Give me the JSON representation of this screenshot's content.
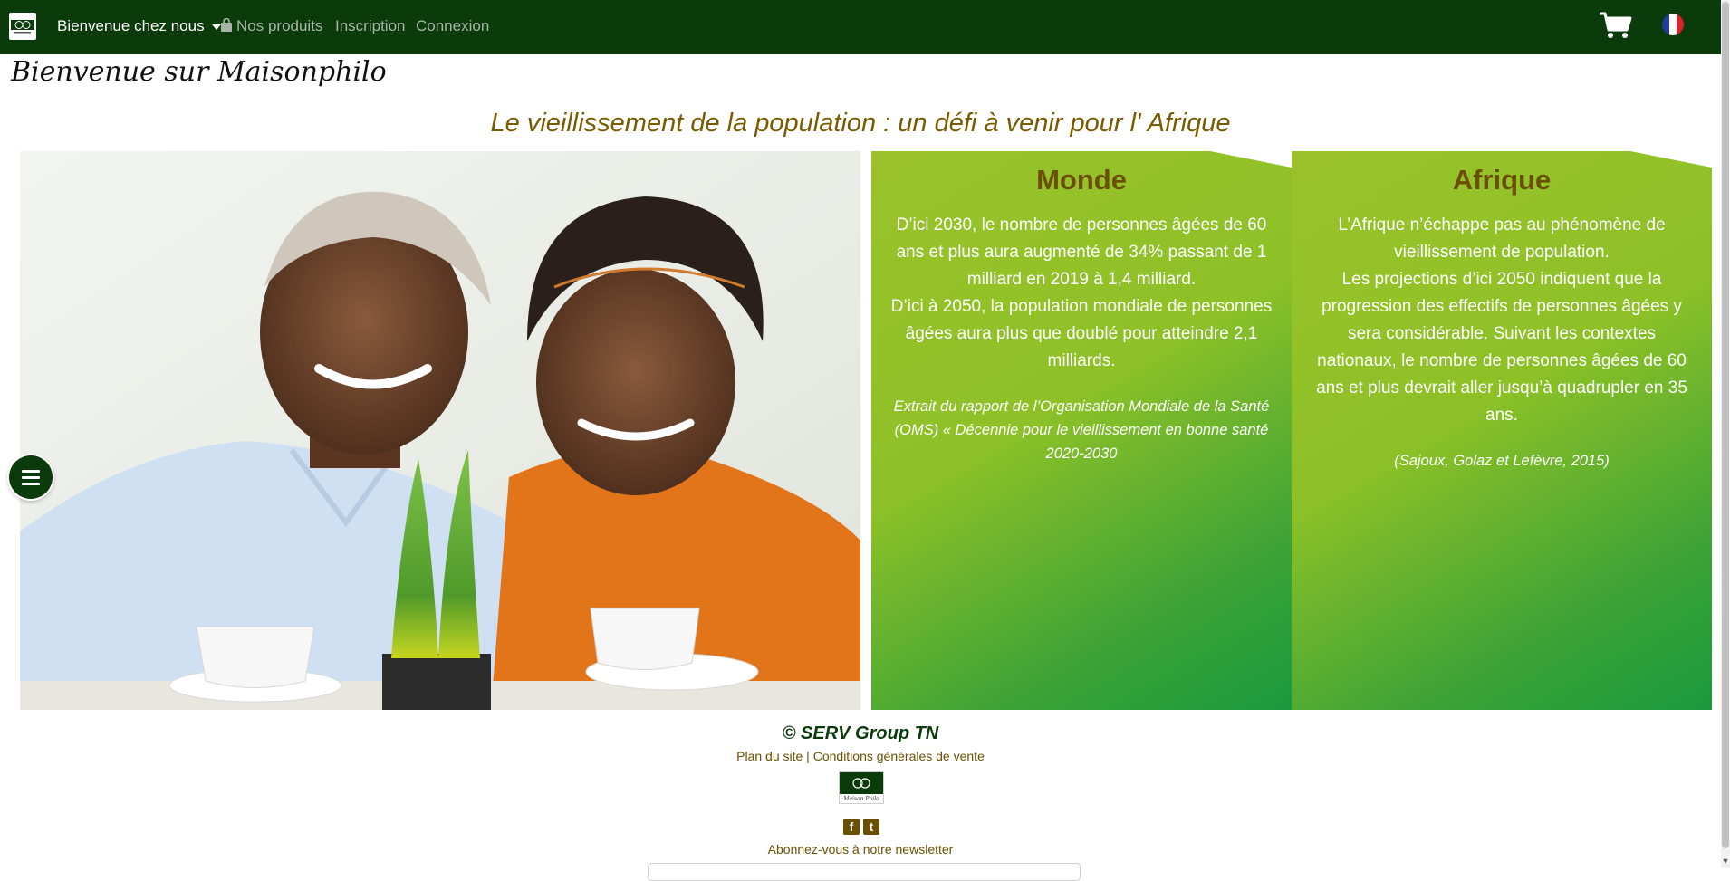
{
  "navbar": {
    "menu_label": "Bienvenue chez nous",
    "products_label": "Nos produits",
    "signup_label": "Inscription",
    "login_label": "Connexion",
    "colors": {
      "background": "#0b3a0b",
      "active": "#ffffff",
      "muted": "#a8b6a8"
    }
  },
  "page": {
    "welcome": "Bienvenue sur Maisonphilo",
    "subtitle": "Le vieillissement de la population : un défi à venir pour l' Afrique"
  },
  "cards": [
    {
      "title": "Monde",
      "paragraph_1": "D’ici 2030, le nombre de personnes âgées de 60 ans et plus aura augmenté de 34% passant de 1 milliard en 2019 à 1,4 milliard.",
      "paragraph_2": "D’ici à 2050, la population mondiale de personnes âgées aura plus que doublé pour atteindre 2,1 milliards.",
      "source": "Extrait du rapport de l’Organisation Mondiale de la Santé (OMS) « Décennie pour le vieillissement en bonne santé 2020-2030"
    },
    {
      "title": "Afrique",
      "paragraph_1": "L’Afrique n’échappe pas au phénomène de vieillissement de population.",
      "paragraph_2": "Les projections d’ici 2050 indiquent que la progression des effectifs de personnes âgées y sera considérable. Suivant les contextes nationaux, le nombre de personnes âgées de 60 ans et plus devrait aller jusqu’à quadrupler en 35 ans.",
      "source": "(Sajoux, Golaz et Lefèvre, 2015)"
    }
  ],
  "footer": {
    "copyright": "© SERV Group TN",
    "sitemap_link": "Plan du site",
    "separator": " | ",
    "terms_link": "Conditions générales de vente",
    "logo_text": "Maison Philo",
    "newsletter_label": "Abonnez-vous à notre newsletter",
    "social_facebook": "f",
    "social_twitter": "t"
  },
  "icons": {
    "brand": "maisonphilo-logo-icon",
    "products": "shopping-bag-icon",
    "cart": "shopping-cart-icon",
    "language": "french-flag-icon",
    "menu": "hamburger-menu-icon"
  },
  "colors": {
    "accent_brown": "#6b4f00",
    "subtitle": "#7a5b00",
    "card_green_light": "#8dc127",
    "card_green_dark": "#1a9a3d"
  }
}
